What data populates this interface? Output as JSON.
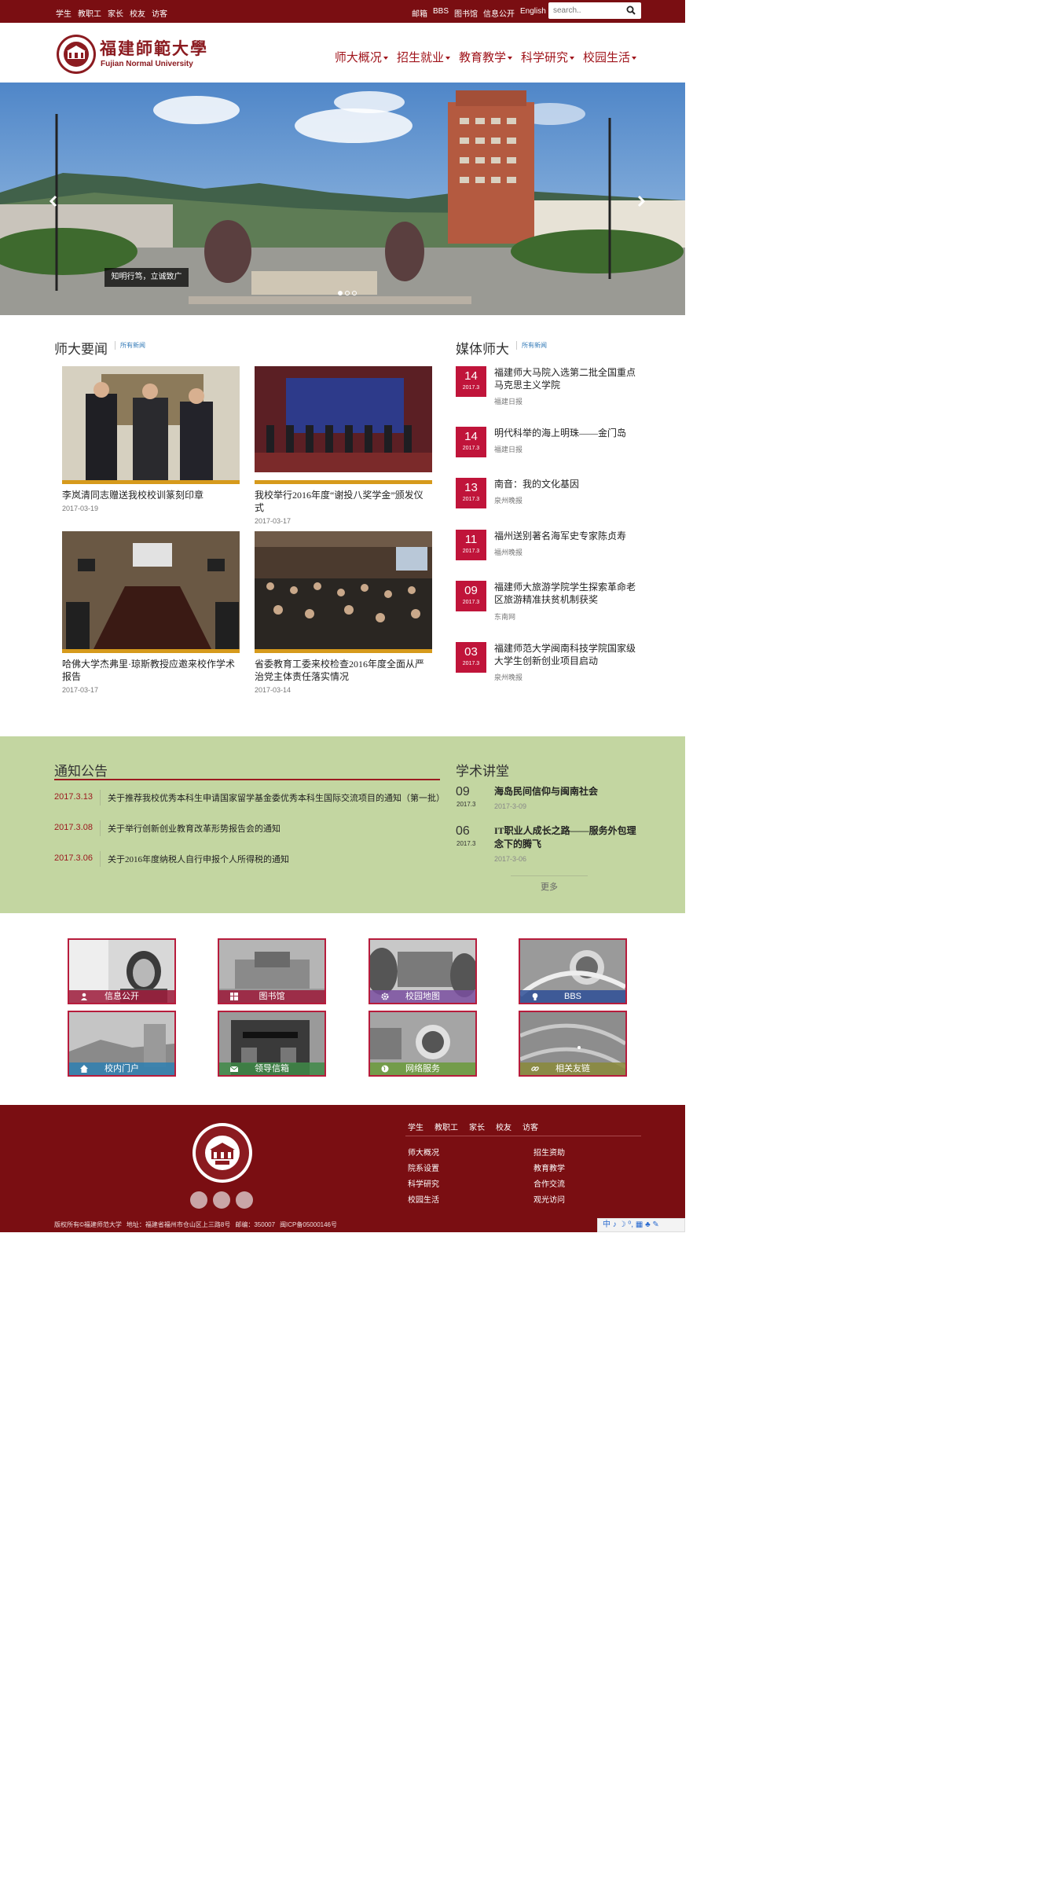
{
  "topbar": {
    "left_links": [
      "学生",
      "教职工",
      "家长",
      "校友",
      "访客"
    ],
    "right_links": [
      "邮箱",
      "BBS",
      "图书馆",
      "信息公开",
      "English"
    ],
    "search_placeholder": "search.."
  },
  "header": {
    "logo_cn": "福建師範大學",
    "logo_en": "Fujian Normal University",
    "nav": [
      "师大概况",
      "招生就业",
      "教育教学",
      "科学研究",
      "校园生活"
    ]
  },
  "banner": {
    "caption": "知明行笃，立诚致广",
    "slide_count": 3,
    "active_slide": 1
  },
  "news": {
    "title": "师大要闻",
    "more": "所有新闻",
    "items": [
      {
        "title": "李岚清同志赠送我校校训篆刻印章",
        "date": "2017-03-19"
      },
      {
        "title": "我校举行2016年度“谢投八奖学金”颁发仪式",
        "date": "2017-03-17"
      },
      {
        "title": "哈佛大学杰弗里·琼斯教授应邀来校作学术报告",
        "date": "2017-03-17"
      },
      {
        "title": "省委教育工委来校检查2016年度全面从严治党主体责任落实情况",
        "date": "2017-03-14"
      }
    ]
  },
  "media": {
    "title": "媒体师大",
    "more": "所有新闻",
    "items": [
      {
        "day": "14",
        "month": "2017.3",
        "title": "福建师大马院入选第二批全国重点马克思主义学院",
        "source": "福建日报"
      },
      {
        "day": "14",
        "month": "2017.3",
        "title": "明代科举的海上明珠——金门岛",
        "source": "福建日报"
      },
      {
        "day": "13",
        "month": "2017.3",
        "title": "南音：我的文化基因",
        "source": "泉州晚报"
      },
      {
        "day": "11",
        "month": "2017.3",
        "title": "福州送别著名海军史专家陈贞寿",
        "source": "福州晚报"
      },
      {
        "day": "09",
        "month": "2017.3",
        "title": "福建师大旅游学院学生探索革命老区旅游精准扶贫机制获奖",
        "source": "东南网"
      },
      {
        "day": "03",
        "month": "2017.3",
        "title": "福建师范大学闽南科技学院国家级大学生创新创业项目启动",
        "source": "泉州晚报"
      }
    ]
  },
  "notices": {
    "title": "通知公告",
    "items": [
      {
        "date": "2017.3.13",
        "text": "关于推荐我校优秀本科生申请国家留学基金委优秀本科生国际交流项目的通知（第一批）"
      },
      {
        "date": "2017.3.08",
        "text": "关于举行创新创业教育改革形势报告会的通知"
      },
      {
        "date": "2017.3.06",
        "text": "关于2016年度纳税人自行申报个人所得税的通知"
      }
    ]
  },
  "lectures": {
    "title": "学术讲堂",
    "more": "更多",
    "items": [
      {
        "day": "09",
        "year": "2017.3",
        "title": "海岛民间信仰与闽南社会",
        "date": "2017-3-09"
      },
      {
        "day": "06",
        "year": "2017.3",
        "title": "IT职业人成长之路——服务外包理念下的腾飞",
        "date": "2017-3-06"
      }
    ]
  },
  "tiles": [
    {
      "label": "信息公开",
      "icon": "user-icon",
      "color": "#9c1a3a"
    },
    {
      "label": "图书馆",
      "icon": "windows-icon",
      "color": "#9c1a3a"
    },
    {
      "label": "校园地图",
      "icon": "gear-icon",
      "color": "#7a4fa0"
    },
    {
      "label": "BBS",
      "icon": "bulb-icon",
      "color": "#2e4f96"
    },
    {
      "label": "校内门户",
      "icon": "home-icon",
      "color": "#2e7fb0"
    },
    {
      "label": "领导信箱",
      "icon": "envelope-icon",
      "color": "#3f8a48"
    },
    {
      "label": "网络服务",
      "icon": "globe-icon",
      "color": "#6a9a3a"
    },
    {
      "label": "相关友链",
      "icon": "link-icon",
      "color": "#8a8a3a"
    }
  ],
  "footer": {
    "top_links": [
      "学生",
      "教职工",
      "家长",
      "校友",
      "访客"
    ],
    "col1": [
      "师大概况",
      "院系设置",
      "科学研究",
      "校园生活"
    ],
    "col2": [
      "招生资助",
      "教育教学",
      "合作交流",
      "观光访问"
    ],
    "copyright": "版权所有©福建师范大学",
    "address": "地址：福建省福州市仓山区上三路8号",
    "postcode": "邮编：350007",
    "icp": "闽ICP备05000146号"
  },
  "ime": "中 ♪ ☽ ⁰, ▦ ♣ ✎"
}
